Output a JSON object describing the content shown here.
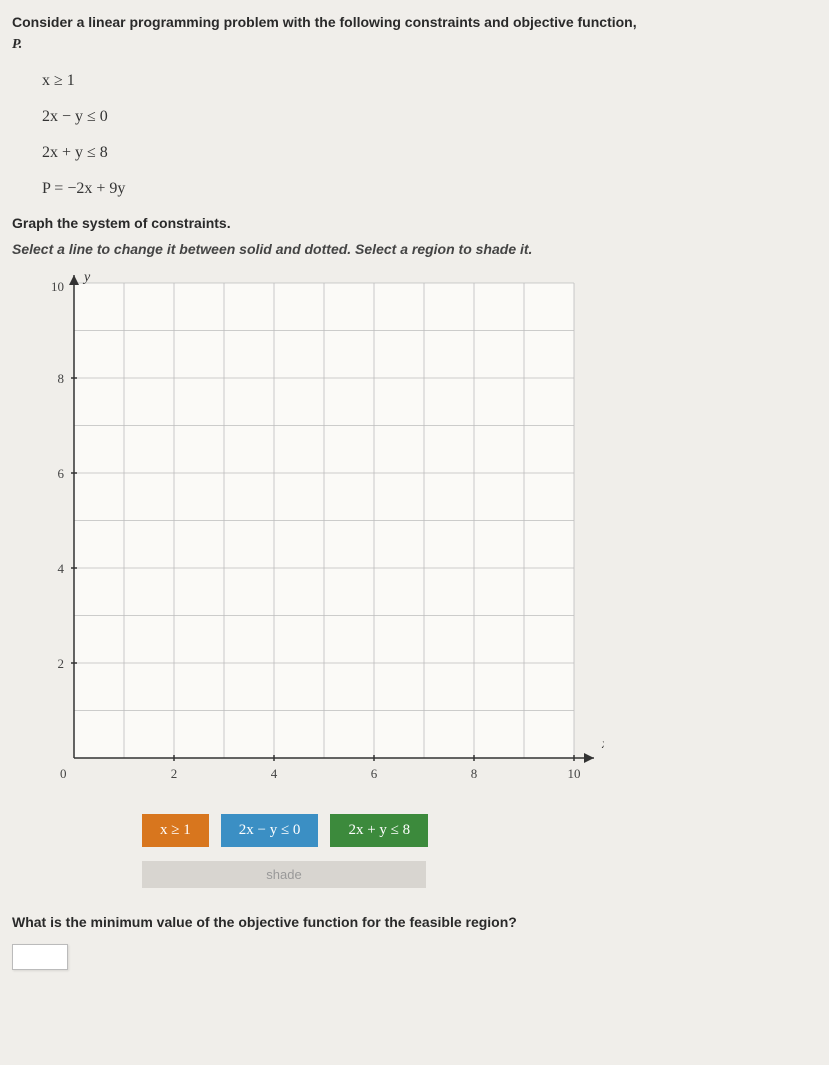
{
  "intro": "Consider a linear programming problem with the following constraints and objective function,",
  "intro_var": "P.",
  "constraints": {
    "c1": "x ≥ 1",
    "c2": "2x − y ≤ 0",
    "c3": "2x + y ≤ 8",
    "obj": "P = −2x + 9y"
  },
  "graph_instr": "Graph the system of constraints.",
  "select_instr": "Select a line to change it between solid and dotted. Select a region to shade it.",
  "buttons": {
    "b1": "x ≥ 1",
    "b2": "2x − y ≤ 0",
    "b3": "2x + y ≤ 8"
  },
  "shade_label": "shade",
  "final_q": "What is the minimum value of the objective function for the feasible region?",
  "chart_data": {
    "type": "scatter",
    "title": "",
    "xlabel": "x",
    "ylabel": "y",
    "xlim": [
      0,
      10
    ],
    "ylim": [
      0,
      10
    ],
    "xticks": [
      0,
      2,
      4,
      6,
      8,
      10
    ],
    "yticks": [
      0,
      2,
      4,
      6,
      8,
      10
    ],
    "series": []
  }
}
